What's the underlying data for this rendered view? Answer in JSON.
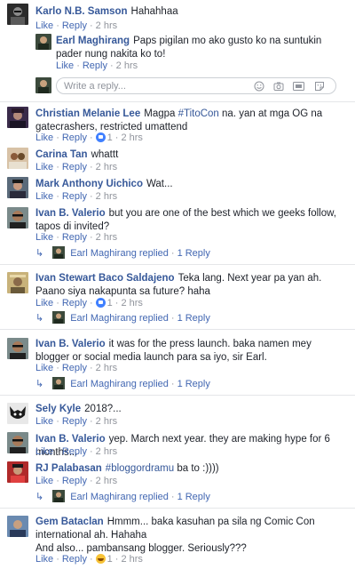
{
  "common": {
    "like": "Like",
    "reply": "Reply",
    "dot": "·"
  },
  "thread": {
    "c1": {
      "name": "Karlo N.B. Samson",
      "text": "Hahahhaa",
      "time": "2 hrs"
    },
    "c1r1": {
      "name": "Earl Maghirang",
      "text": "Paps pigilan mo ako gusto ko na suntukin pader nung nakita ko to!",
      "time": "2 hrs"
    },
    "write_reply": {
      "placeholder": "Write a reply..."
    },
    "c2": {
      "name": "Christian Melanie Lee",
      "text_pre": "Magpa ",
      "tag": "#TitoCon",
      "text_post": " na. yan at mga OG na gatecrashers, restricted umattend",
      "likes": "1",
      "time": "2 hrs"
    },
    "c3": {
      "name": "Carina Tan",
      "text": "whattt",
      "time": "2 hrs"
    },
    "c4": {
      "name": "Mark Anthony Uichico",
      "text": "Wat...",
      "time": "2 hrs"
    },
    "c5": {
      "name": "Ivan B. Valerio",
      "text": "but you are one of the best which we geeks follow, tapos di invited?",
      "time": "2 hrs",
      "replies": "Earl Maghirang replied",
      "reply_count": "1 Reply"
    },
    "c6": {
      "name": "Ivan Stewart Baco Saldajeno",
      "text": "Teka lang. Next year pa yan ah. Paano siya nakapunta sa future? haha",
      "likes": "1",
      "time": "2 hrs",
      "replies": "Earl Maghirang replied",
      "reply_count": "1 Reply"
    },
    "c7": {
      "name": "Ivan B. Valerio",
      "text": "it was for the press launch. baka namen mey blogger or social media launch para sa iyo, sir Earl.",
      "time": "2 hrs",
      "replies": "Earl Maghirang replied",
      "reply_count": "1 Reply"
    },
    "c8": {
      "name": "Sely Kyle",
      "text": "2018?...",
      "time": "2 hrs"
    },
    "c9": {
      "name": "Ivan B. Valerio",
      "text": "yep. March next year. they are making hype for 6 months...",
      "time": "2 hrs"
    },
    "c10": {
      "name": "RJ Palabasan",
      "tag": "#bloggordramu",
      "text_post": " ba to :))))",
      "time": "2 hrs",
      "replies": "Earl Maghirang replied",
      "reply_count": "1 Reply"
    },
    "c11": {
      "name": "Gem Bataclan",
      "text": "Hmmm... baka kasuhan pa sila ng Comic Con international ah. Hahaha",
      "text2": "And also... pambansang blogger. Seriously???",
      "reactions": "1",
      "time": "2 hrs"
    }
  },
  "icons": [
    "smiley-icon",
    "camera-icon",
    "gif-icon",
    "sticker-icon",
    "reply-arrow-icon",
    "like-reaction-icon",
    "haha-reaction-icon"
  ],
  "colors": {
    "name": "#365899",
    "link": "#4267b2",
    "meta": "#90949c",
    "text": "#1d2129",
    "like": "#4080ff",
    "separator": "#e5e6e9"
  }
}
